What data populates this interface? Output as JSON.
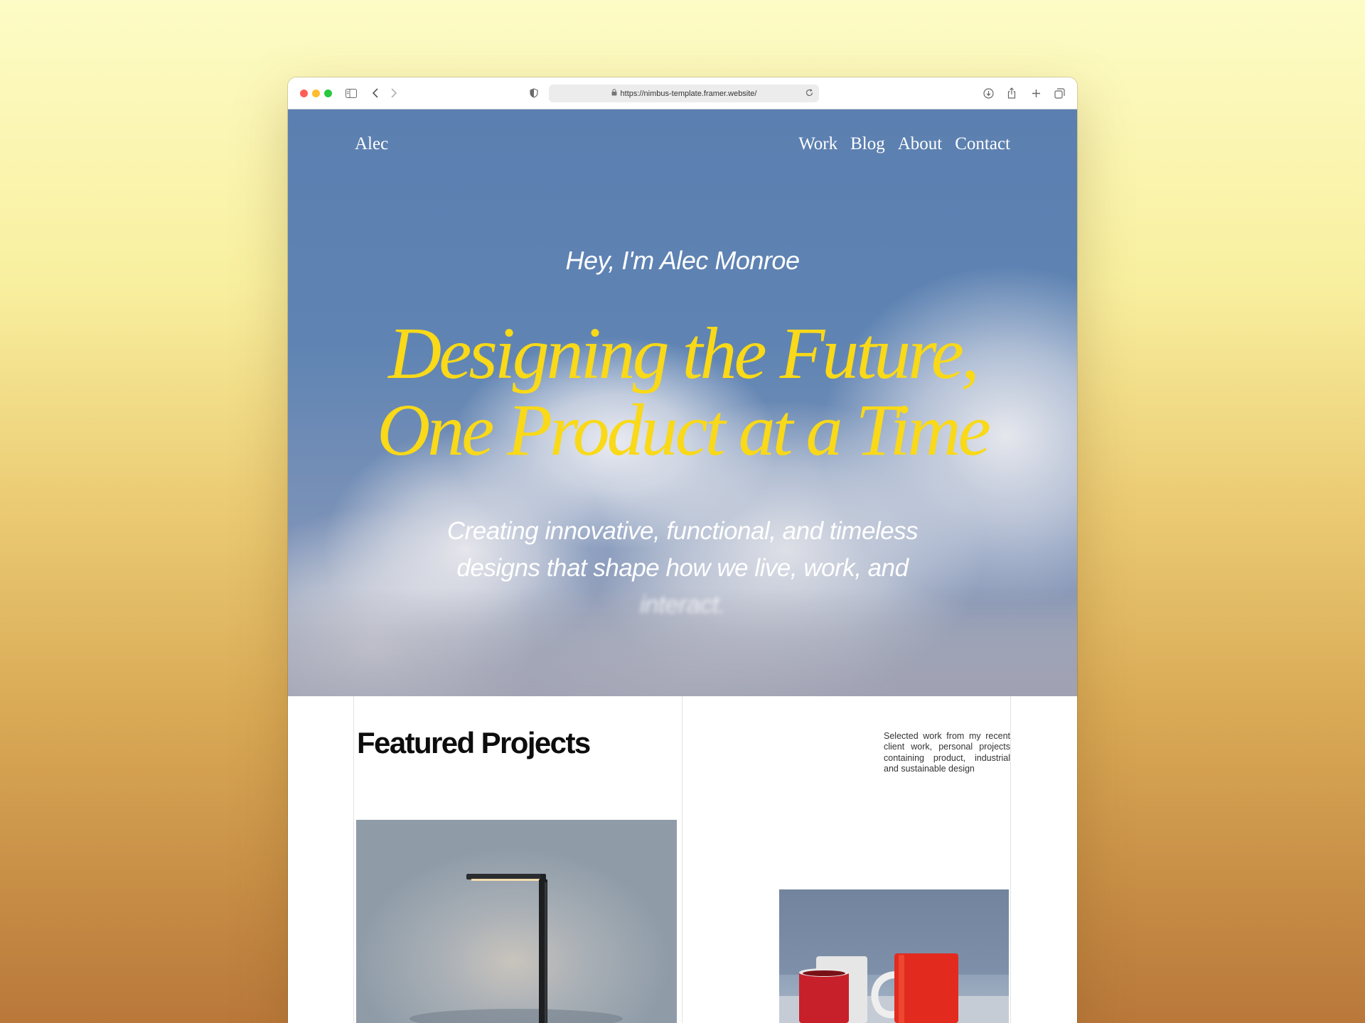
{
  "browser": {
    "url": "https://nimbus-template.framer.website/"
  },
  "nav": {
    "logo": "Alec",
    "links": [
      "Work",
      "Blog",
      "About",
      "Contact"
    ]
  },
  "hero": {
    "intro": "Hey, I'm Alec Monroe",
    "title": "Designing the Future, One Product at a Time",
    "subtitle": "Creating innovative, functional, and timeless designs that shape how we live, work, and interact.",
    "title_color": "#f9d918"
  },
  "featured": {
    "title": "Featured Projects",
    "description": "Selected work from my recent client work, personal projects containing product, industrial and sustainable design"
  },
  "icons": [
    "sidebar-icon",
    "back-icon",
    "forward-icon",
    "privacy-shield-icon",
    "lock-icon",
    "reload-icon",
    "download-icon",
    "share-icon",
    "new-tab-icon",
    "tabs-overview-icon"
  ]
}
